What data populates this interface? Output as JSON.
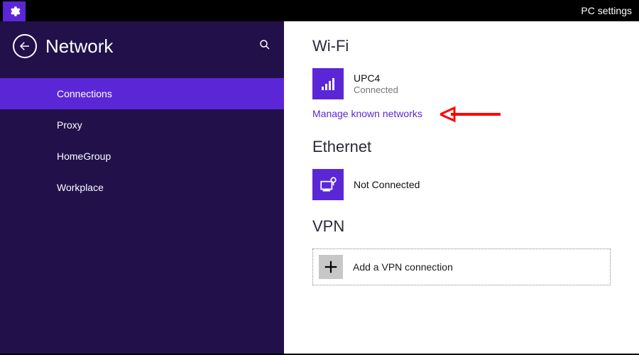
{
  "topbar": {
    "title": "PC settings"
  },
  "sidebar": {
    "title": "Network",
    "items": [
      {
        "label": "Connections",
        "active": true
      },
      {
        "label": "Proxy",
        "active": false
      },
      {
        "label": "HomeGroup",
        "active": false
      },
      {
        "label": "Workplace",
        "active": false
      }
    ]
  },
  "content": {
    "wifi": {
      "heading": "Wi-Fi",
      "network_name": "UPC4",
      "status": "Connected",
      "manage_link": "Manage known networks"
    },
    "ethernet": {
      "heading": "Ethernet",
      "status": "Not Connected"
    },
    "vpn": {
      "heading": "VPN",
      "add_label": "Add a VPN connection"
    }
  },
  "colors": {
    "accent": "#5b27d6",
    "sidebar_bg": "#21104a",
    "annotation": "#ff0000"
  }
}
